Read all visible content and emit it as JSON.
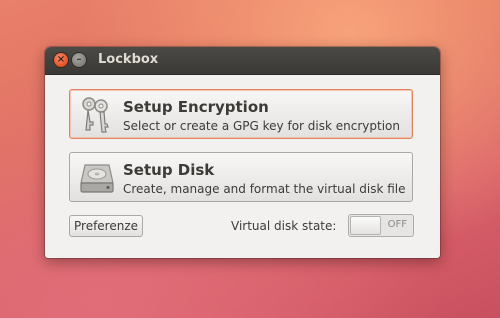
{
  "window": {
    "title": "Lockbox"
  },
  "buttons": {
    "setup_encryption": {
      "title": "Setup Encryption",
      "subtitle": "Select or create a GPG key for disk encryption",
      "icon": "keys-icon"
    },
    "setup_disk": {
      "title": "Setup Disk",
      "subtitle": "Create, manage and format the virtual disk file",
      "icon": "hard-disk-icon"
    },
    "preferences": {
      "label": "Preferenze"
    }
  },
  "virtual_disk": {
    "label": "Virtual disk state:",
    "state": "OFF"
  },
  "colors": {
    "titlebar": "#3c3b37",
    "close_button": "#e25122",
    "focus_border": "#e4835f"
  }
}
